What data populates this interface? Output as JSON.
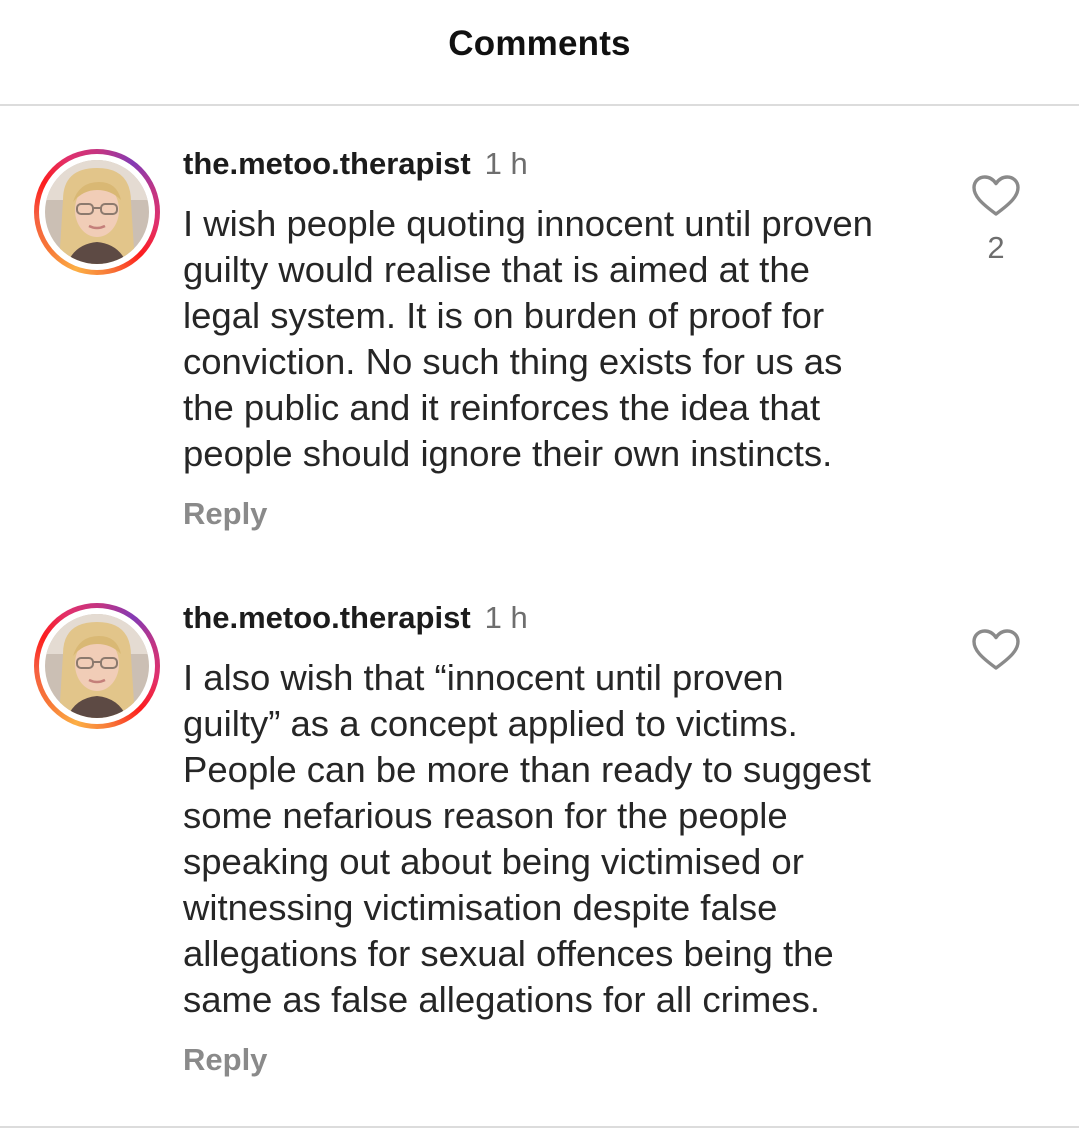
{
  "header": {
    "title": "Comments"
  },
  "comments": [
    {
      "username": "the.metoo.therapist",
      "time": "1 h",
      "text": "I wish people quoting innocent until proven\nguilty would realise that is aimed at the\nlegal system. It is on burden of proof for\nconviction. No such thing exists for us as\nthe public and it reinforces the idea that\npeople should ignore their own instincts.",
      "reply_label": "Reply",
      "like_count": "2",
      "like_icon": "heart-outline-icon"
    },
    {
      "username": "the.metoo.therapist",
      "time": "1 h",
      "text": "I also wish that “innocent until proven\nguilty” as a concept applied to victims.\nPeople can be more than ready to suggest\nsome nefarious reason for the people\nspeaking out about being victimised or\nwitnessing victimisation despite false\nallegations for sexual offences being the\nsame as false allegations for all crimes.",
      "reply_label": "Reply",
      "like_icon": "heart-outline-icon"
    }
  ],
  "colors": {
    "ring_start": "#fcaf45",
    "ring_mid": "#e1306c",
    "ring_end": "#833ab4",
    "muted_text": "#8a8a8a"
  }
}
